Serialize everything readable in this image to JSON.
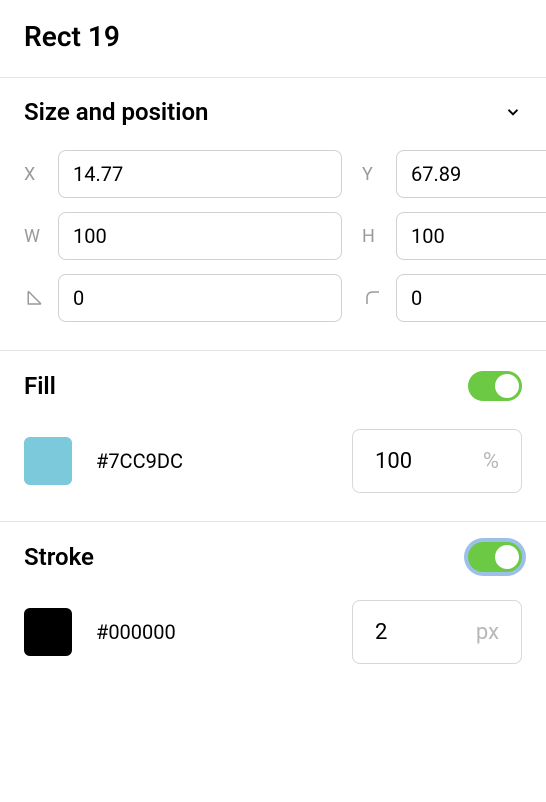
{
  "title": "Rect 19",
  "sections": {
    "sizePosition": {
      "title": "Size and position",
      "fields": {
        "xLabel": "X",
        "x": "14.77",
        "yLabel": "Y",
        "y": "67.89",
        "wLabel": "W",
        "w": "100",
        "hLabel": "H",
        "h": "100",
        "rotation": "0",
        "cornerRadius": "0"
      }
    },
    "fill": {
      "title": "Fill",
      "enabled": true,
      "color": "#7CC9DC",
      "opacity": "100",
      "opacityUnit": "%"
    },
    "stroke": {
      "title": "Stroke",
      "enabled": true,
      "color": "#000000",
      "width": "2",
      "widthUnit": "px"
    }
  }
}
